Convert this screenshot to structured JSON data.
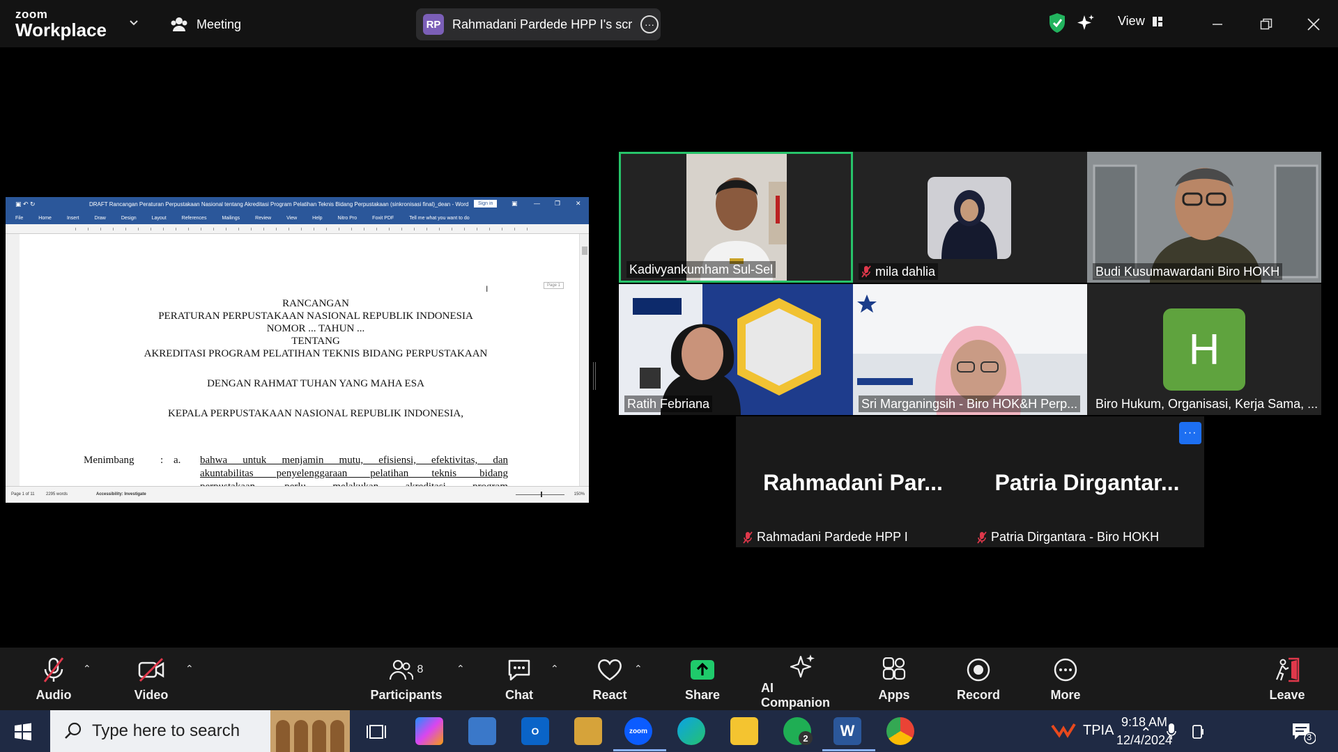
{
  "app": {
    "brand_top": "zoom",
    "brand_bottom": "Workplace"
  },
  "header": {
    "meeting_label": "Meeting",
    "share_initials": "RP",
    "share_label": "Rahmadani Pardede HPP I's scree",
    "view_label": "View"
  },
  "shared_doc": {
    "window_title": "DRAFT Rancangan Peraturan Perpustakaan Nasional tentang Akreditasi Program Pelatihan Teknis Bidang Perpustakaan (sinkronisasi final)_dean  -  Word",
    "sign_in": "Sign in",
    "ribbon": [
      "File",
      "Home",
      "Insert",
      "Draw",
      "Design",
      "Layout",
      "References",
      "Mailings",
      "Review",
      "View",
      "Help",
      "Nitro Pro",
      "Foxit PDF",
      "Tell me what you want to do"
    ],
    "page_tag": "Page 1",
    "lines": [
      "RANCANGAN",
      "PERATURAN PERPUSTAKAAN NASIONAL REPUBLIK INDONESIA",
      "NOMOR ... TAHUN ...",
      "TENTANG",
      "AKREDITASI PROGRAM PELATIHAN TEKNIS BIDANG PERPUSTAKAAN",
      "DENGAN RAHMAT TUHAN YANG MAHA ESA",
      "KEPALA PERPUSTAKAAN NASIONAL REPUBLIK INDONESIA,"
    ],
    "menimbang_label": "Menimbang",
    "menimbang_colon": ":",
    "menimbang_item": "a.",
    "menimbang_text": [
      "bahwa untuk menjamin mutu, efisiensi, efektivitas, dan",
      "akuntabilitas penyelenggaraan pelatihan teknis bidang",
      "perpustakaan, perlu melakukan akreditasi program"
    ],
    "status_page": "Page 1 of 11",
    "status_words": "2295 words",
    "status_accessibility": "Accessibility: Investigate",
    "status_zoom": "150%"
  },
  "participants": [
    {
      "name": "Kadivyankumham Sul-Sel",
      "muted": false,
      "active": true
    },
    {
      "name": "mila dahlia",
      "muted": true
    },
    {
      "name": "Budi Kusumawardani Biro HOKH",
      "muted": false
    },
    {
      "name": "Ratih Febriana",
      "muted": false
    },
    {
      "name": "Sri Marganingsih - Biro HOK&H Perp...",
      "muted": false
    },
    {
      "name": "Biro Hukum, Organisasi, Kerja Sama, ...",
      "muted": false,
      "avatar": "H"
    }
  ],
  "big_tiles": [
    {
      "display": "Rahmadani  Par...",
      "name": "Rahmadani Pardede HPP I"
    },
    {
      "display": "Patria  Dirgantar...",
      "name": "Patria Dirgantara - Biro HOKH"
    }
  ],
  "controls": {
    "audio": "Audio",
    "video": "Video",
    "participants": "Participants",
    "participants_count": "8",
    "chat": "Chat",
    "react": "React",
    "share": "Share",
    "ai": "AI Companion",
    "apps": "Apps",
    "record": "Record",
    "more": "More",
    "leave": "Leave"
  },
  "taskbar": {
    "search_placeholder": "Type here to search",
    "stock": "TPIA",
    "time": "9:18 AM",
    "date": "12/4/2024",
    "notif_count": "3",
    "whatsapp_badge": "2"
  },
  "colors": {
    "accent_green": "#27c46a",
    "share_green": "#1fca6b",
    "word_blue": "#2b579a",
    "zoom_blue": "#1d6ff2",
    "leave_red": "#e0384b"
  }
}
